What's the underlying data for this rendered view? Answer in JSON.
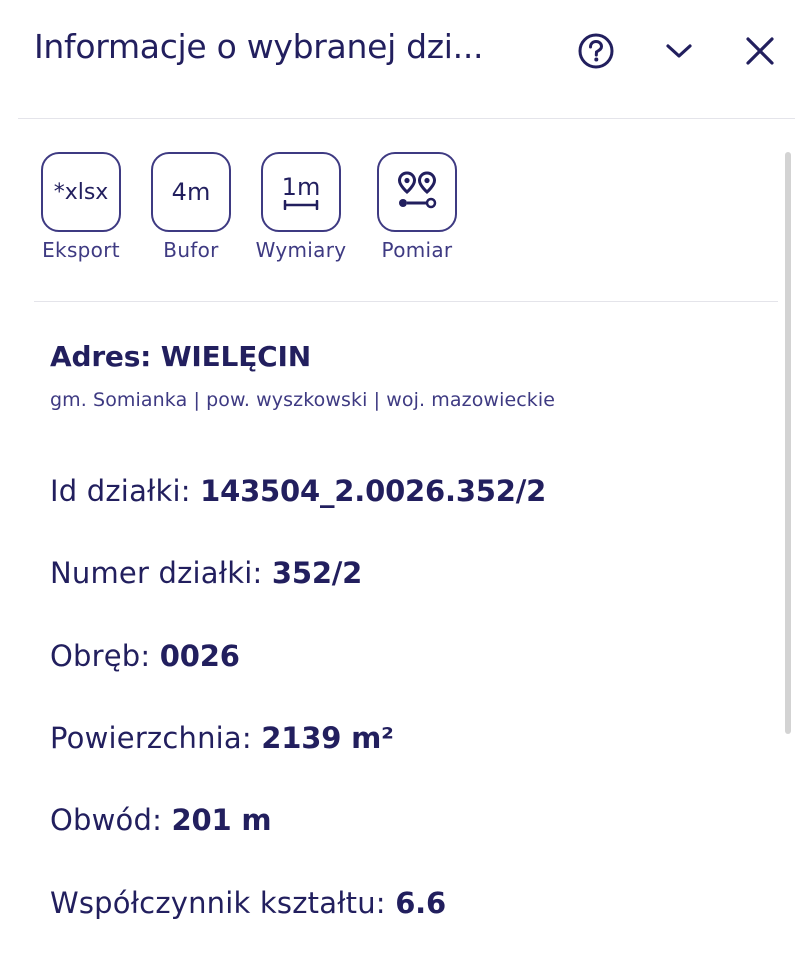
{
  "header": {
    "title": "Informacje o wybranej dzi...",
    "help_icon": "help-circle-icon",
    "collapse_icon": "chevron-down-icon",
    "close_icon": "close-icon"
  },
  "tools": [
    {
      "box_text": "*xlsx",
      "label": "Eksport",
      "icon": "xlsx-export-icon"
    },
    {
      "box_text": "4m",
      "label": "Bufor",
      "icon": "buffer-icon"
    },
    {
      "box_text": "1m",
      "label": "Wymiary",
      "icon": "dimensions-icon"
    },
    {
      "box_text": "",
      "label": "Pomiar",
      "icon": "measure-pins-icon"
    }
  ],
  "address": {
    "title": "Adres: WIELĘCIN",
    "subtitle": "gm. Somianka | pow. wyszkowski | woj. mazowieckie"
  },
  "properties": [
    {
      "label": "Id działki: ",
      "value": "143504_2.0026.352/2"
    },
    {
      "label": "Numer działki: ",
      "value": "352/2"
    },
    {
      "label": "Obręb: ",
      "value": "0026"
    },
    {
      "label": "Powierzchnia: ",
      "value": "2139 m²"
    },
    {
      "label": "Obwód: ",
      "value": "201 m"
    },
    {
      "label": "Współczynnik kształtu: ",
      "value": "6.6"
    }
  ],
  "colors": {
    "text": "#221f5e",
    "accent": "#3e3a82",
    "divider": "#e4e4ea",
    "scrollbar": "#d3d3d3"
  }
}
